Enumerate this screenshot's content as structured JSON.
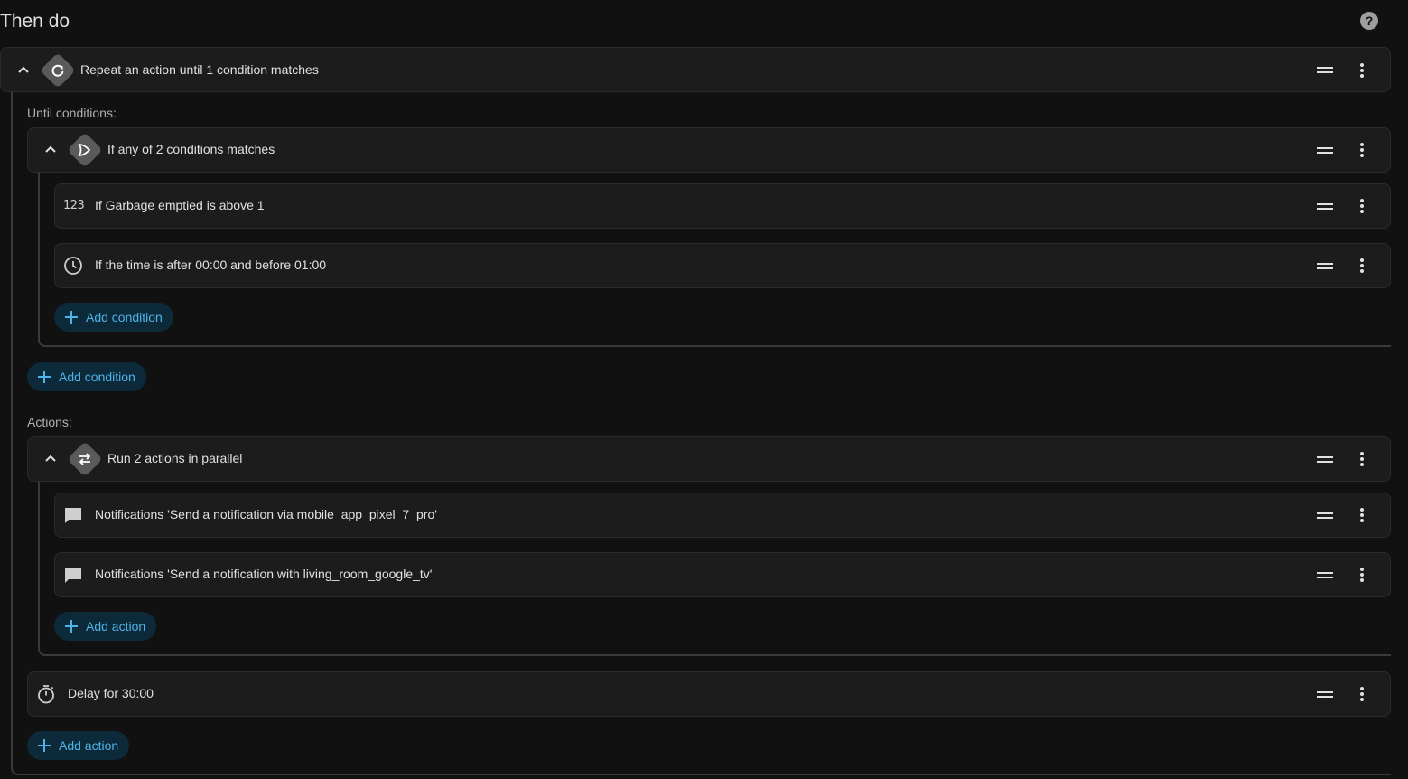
{
  "section_title": "Then do",
  "repeat": {
    "label": "Repeat an action until 1 condition matches",
    "until_label": "Until conditions:",
    "or_block": {
      "label": "If any of 2 conditions matches",
      "conditions": [
        {
          "icon": "numeric-icon",
          "icon_text": "123",
          "label": "If Garbage emptied is above 1"
        },
        {
          "icon": "clock-icon",
          "label": "If the time is after 00:00 and before 01:00"
        }
      ],
      "add_condition_label": "Add condition"
    },
    "add_condition_label": "Add condition",
    "actions_label": "Actions:",
    "parallel_block": {
      "label": "Run 2 actions in parallel",
      "actions": [
        {
          "icon": "message-icon",
          "label": "Notifications 'Send a notification via mobile_app_pixel_7_pro'"
        },
        {
          "icon": "message-icon",
          "label": "Notifications 'Send a notification with living_room_google_tv'"
        }
      ],
      "add_action_label": "Add action"
    },
    "delay": {
      "icon": "timer-icon",
      "label": "Delay for 30:00"
    },
    "add_action_label": "Add action"
  },
  "colors": {
    "background": "#111111",
    "card": "#1c1c1c",
    "accent": "#4fb3e8",
    "accent_bg": "#0d2a3a",
    "badge": "#5a5a5a"
  }
}
